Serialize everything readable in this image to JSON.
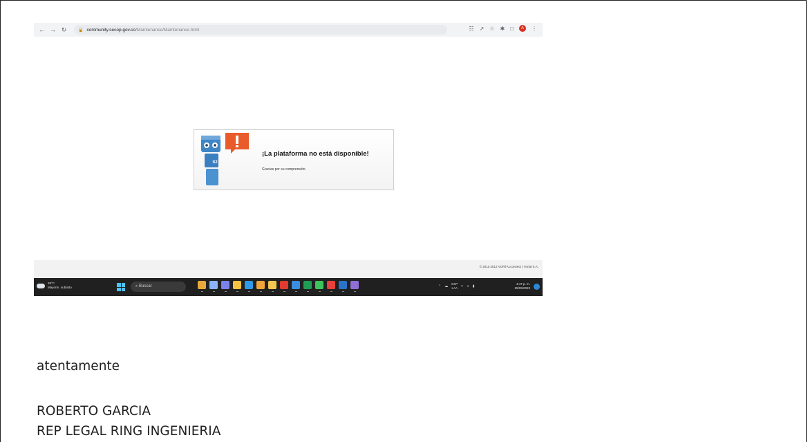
{
  "browser": {
    "url_host": "community.secop.gov.co",
    "url_path": "/Maintenance/Maintenance.html",
    "profile_initial": "A"
  },
  "notice": {
    "robot_badge": "S2",
    "title": "¡La plataforma no está disponible!",
    "subtitle": "Gracias por su comprensión."
  },
  "footer": {
    "copyright": "© 2011-2012 VORTALconnect | Vortal S.A."
  },
  "taskbar": {
    "weather_temp": "28°C",
    "weather_desc": "Mayorm. nublado",
    "search_placeholder": "Buscar",
    "lang_top": "ESP",
    "lang_bottom": "LAA",
    "time": "4:47 p. m.",
    "date": "25/09/2023",
    "apps": [
      {
        "name": "widgets-icon",
        "color": "#e8a93a"
      },
      {
        "name": "task-view-icon",
        "color": "#8ab4f8"
      },
      {
        "name": "chat-icon",
        "color": "#7b83eb"
      },
      {
        "name": "file-explorer-icon",
        "color": "#f6c343"
      },
      {
        "name": "edge-icon",
        "color": "#2f9be8"
      },
      {
        "name": "chrome-icon",
        "color": "#f2a33a"
      },
      {
        "name": "folder-icon",
        "color": "#f5c64f"
      },
      {
        "name": "acrobat-icon",
        "color": "#e03b30"
      },
      {
        "name": "store-icon",
        "color": "#3a8de0"
      },
      {
        "name": "excel-icon",
        "color": "#1f9d55"
      },
      {
        "name": "whatsapp-icon",
        "color": "#3cc35a"
      },
      {
        "name": "acrobat-reader-icon",
        "color": "#e8403a"
      },
      {
        "name": "outlook-icon",
        "color": "#2a72c8"
      },
      {
        "name": "snip-icon",
        "color": "#8f6ed5"
      }
    ]
  },
  "signature": {
    "closing": "atentamente",
    "name": "ROBERTO GARCIA",
    "title": "REP LEGAL RING INGENIERIA"
  }
}
